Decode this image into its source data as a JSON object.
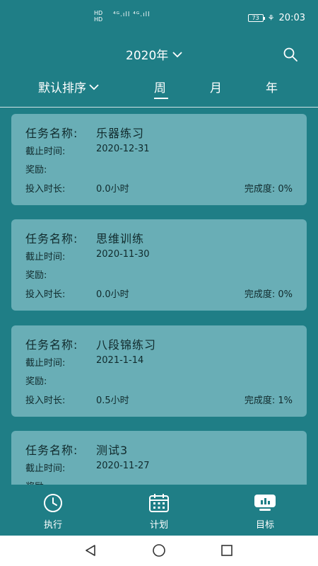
{
  "status_bar": {
    "hd_top": "HD",
    "hd_bottom": "HD",
    "signal_text": "⁴ᴳ.ıll ⁴ᴳ.ıll",
    "battery": "73",
    "time": "20:03"
  },
  "header": {
    "year": "2020年"
  },
  "tabs": {
    "sort_label": "默认排序",
    "week": "周",
    "month": "月",
    "year": "年"
  },
  "tasks": [
    {
      "task_label": "任务名称:",
      "name": "乐器练习",
      "deadline_label": "截止时间:",
      "deadline": "2020-12-31",
      "reward_label": "奖励:",
      "time_label": "投入时长:",
      "time": "0.0小时",
      "completion": "完成度: 0%"
    },
    {
      "task_label": "任务名称:",
      "name": "思维训练",
      "deadline_label": "截止时间:",
      "deadline": "2020-11-30",
      "reward_label": "奖励:",
      "time_label": "投入时长:",
      "time": "0.0小时",
      "completion": "完成度: 0%"
    },
    {
      "task_label": "任务名称:",
      "name": "八段锦练习",
      "deadline_label": "截止时间:",
      "deadline": "2021-1-14",
      "reward_label": "奖励:",
      "time_label": "投入时长:",
      "time": "0.5小时",
      "completion": "完成度: 1%"
    },
    {
      "task_label": "任务名称:",
      "name": "测试3",
      "deadline_label": "截止时间:",
      "deadline": "2020-11-27",
      "reward_label": "奖励:",
      "time_label": "",
      "time": "",
      "completion": ""
    }
  ],
  "bottom_nav": {
    "execute": "执行",
    "plan": "计划",
    "goal": "目标"
  },
  "colors": {
    "background": "#1f7e86",
    "card": "#69aeb6",
    "text_dark": "#102a2c"
  }
}
